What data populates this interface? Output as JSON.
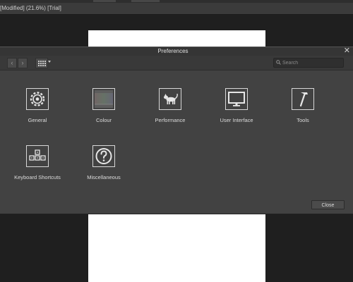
{
  "window": {
    "document_title": "[Modified] (21.6%) [Trial]"
  },
  "dialog": {
    "title": "Preferences",
    "close_glyph": "✕",
    "search_placeholder": "Search",
    "nav_back_glyph": "‹",
    "nav_forward_glyph": "›",
    "close_button_label": "Close"
  },
  "categories": [
    {
      "label": "General",
      "icon": "gear-icon"
    },
    {
      "label": "Colour",
      "icon": "colour-swatch-icon"
    },
    {
      "label": "Performance",
      "icon": "cat-icon"
    },
    {
      "label": "User Interface",
      "icon": "monitor-icon"
    },
    {
      "label": "Tools",
      "icon": "hammer-icon"
    },
    {
      "label": "Keyboard Shortcuts",
      "icon": "keyboard-icon"
    },
    {
      "label": "Miscellaneous",
      "icon": "question-icon"
    }
  ]
}
